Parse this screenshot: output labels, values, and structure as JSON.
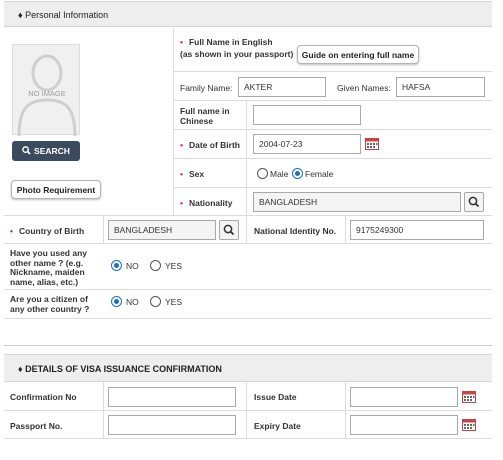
{
  "personal": {
    "header": "♦ Personal Information",
    "photo_placeholder": "NO IMAGE",
    "search_button": "SEARCH",
    "photo_requirement_button": "Photo Requirement",
    "full_name_label_line1": "Full Name in English",
    "full_name_label_line2": "(as shown in your passport)",
    "guide_button": "Guide on entering full name",
    "family_name_label": "Family Name:",
    "family_name_value": "AKTER",
    "given_names_label": "Given Names:",
    "given_names_value": "HAFSA",
    "chinese_label_line1": "Full name in",
    "chinese_label_line2": "Chinese",
    "chinese_value": "",
    "dob_label": "Date of Birth",
    "dob_value": "2004-07-23",
    "sex_label": "Sex",
    "sex_options": [
      "Male",
      "Female"
    ],
    "sex_selected": "Female",
    "nationality_label": "Nationality",
    "nationality_value": "BANGLADESH",
    "country_of_birth_label": "Country of Birth",
    "country_of_birth_value": "BANGLADESH",
    "national_id_label": "National Identity No.",
    "national_id_value": "9175249300",
    "other_name_question": [
      "Have you used any",
      "other name ? (e.g.",
      "Nickname, maiden",
      "name, alias, etc.)"
    ],
    "other_name_options": [
      "NO",
      "YES"
    ],
    "other_name_selected": "NO",
    "citizen_question": [
      "Are you a citizen of",
      "any other country ?"
    ],
    "citizen_options": [
      "NO",
      "YES"
    ],
    "citizen_selected": "NO"
  },
  "visa": {
    "header": "♦ DETAILS OF VISA ISSUANCE CONFIRMATION",
    "confirmation_label": "Confirmation No",
    "confirmation_value": "",
    "issue_date_label": "Issue Date",
    "issue_date_value": "",
    "passport_label": "Passport No.",
    "passport_value": "",
    "expiry_date_label": "Expiry Date",
    "expiry_date_value": ""
  },
  "colors": {
    "required": "#d0253f",
    "radio_selected": "#1a6fc7",
    "search_button_bg": "#3b4a5c"
  }
}
